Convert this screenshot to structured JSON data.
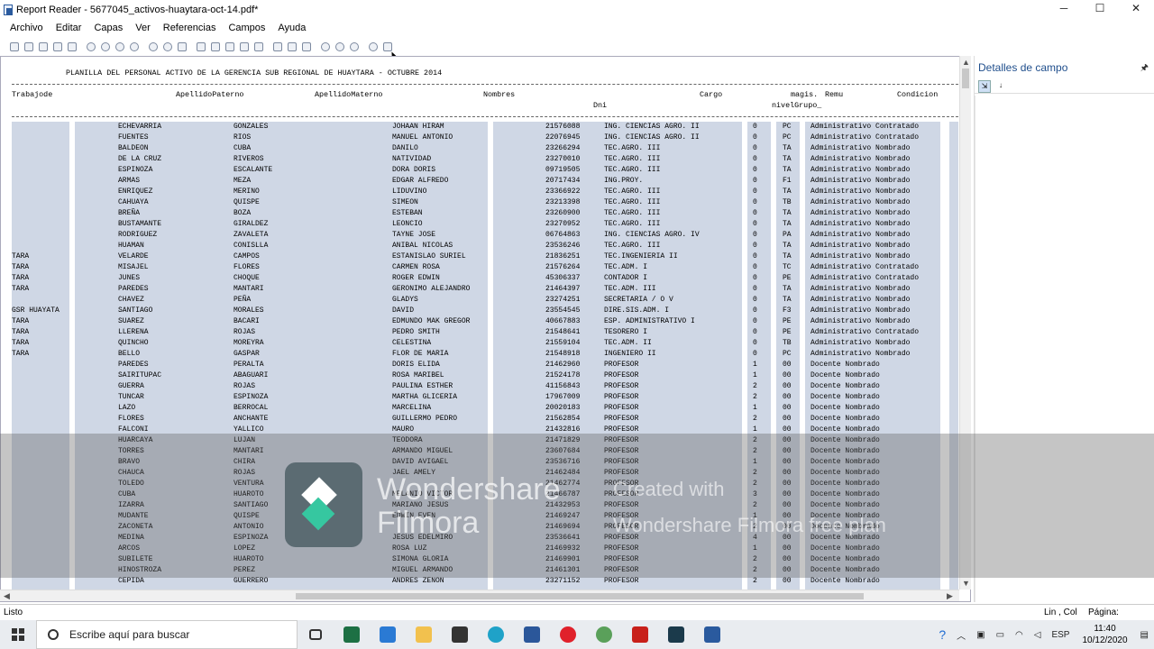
{
  "window": {
    "title": "Report Reader - 5677045_activos-huaytara-oct-14.pdf*",
    "minimize": "─",
    "maximize": "☐",
    "close": "✕"
  },
  "menu": [
    "Archivo",
    "Editar",
    "Capas",
    "Ver",
    "Referencias",
    "Campos",
    "Ayuda"
  ],
  "report": {
    "title": "PLANILLA DEL PERSONAL ACTIVO DE LA GERENCIA SUB REGIONAL DE HUAYTARA - OCTUBRE 2014",
    "headers": {
      "trabajador": "Trabajode",
      "paterno": "ApellidoPaterno",
      "materno": "ApellidoMaterno",
      "nombres": "Nombres",
      "cargo": "Cargo",
      "magis": "magis.",
      "remu": "Remu",
      "condicion": "Condicion",
      "dni": "Dni",
      "nivel": "nivelGrupo_"
    },
    "rows": [
      [
        "",
        "ECHEVARRIA",
        "GONZALES",
        "JOHAAN HIRAM",
        "21576088",
        "ING. CIENCIAS AGRO. II",
        "0",
        "PC",
        "Administrativo Contratado"
      ],
      [
        "",
        "FUENTES",
        "RIOS",
        "MANUEL ANTONIO",
        "22076945",
        "ING. CIENCIAS AGRO. II",
        "0",
        "PC",
        "Administrativo Contratado"
      ],
      [
        "",
        "BALDEON",
        "CUBA",
        "DANILO",
        "23266294",
        "TEC.AGRO.   III",
        "0",
        "TA",
        "Administrativo Nombrado"
      ],
      [
        "",
        "DE LA CRUZ",
        "RIVEROS",
        "NATIVIDAD",
        "23270010",
        "TEC.AGRO.   III",
        "0",
        "TA",
        "Administrativo Nombrado"
      ],
      [
        "",
        "ESPINOZA",
        "ESCALANTE",
        "DORA DORIS",
        "09719505",
        "TEC.AGRO.   III",
        "0",
        "TA",
        "Administrativo Nombrado"
      ],
      [
        "",
        "ARMAS",
        "MEZA",
        "EDGAR ALFREDO",
        "20717434",
        "ING.PROY.",
        "0",
        "F1",
        "Administrativo Nombrado"
      ],
      [
        "",
        "ENRIQUEZ",
        "MERINO",
        "LIDUVINO",
        "23366922",
        "TEC.AGRO.   III",
        "0",
        "TA",
        "Administrativo Nombrado"
      ],
      [
        "",
        "CAHUAYA",
        "QUISPE",
        "SIMEON",
        "23213398",
        "TEC.AGRO.   III",
        "0",
        "TB",
        "Administrativo Nombrado"
      ],
      [
        "",
        "BREÑA",
        "BOZA",
        "ESTEBAN",
        "23260900",
        "TEC.AGRO.   III",
        "0",
        "TA",
        "Administrativo Nombrado"
      ],
      [
        "",
        "BUSTAMANTE",
        "GIRALDEZ",
        "LEONCIO",
        "23270952",
        "TEC.AGRO.   III",
        "0",
        "TA",
        "Administrativo Nombrado"
      ],
      [
        "",
        "RODRIGUEZ",
        "ZAVALETA",
        "TAYNE JOSE",
        "06764863",
        "ING. CIENCIAS AGRO. IV",
        "0",
        "PA",
        "Administrativo Nombrado"
      ],
      [
        "",
        "HUAMAN",
        "CONISLLA",
        "ANIBAL NICOLAS",
        "23536246",
        "TEC.AGRO.   III",
        "0",
        "TA",
        "Administrativo Nombrado"
      ],
      [
        "TARA",
        "VELARDE",
        "CAMPOS",
        "ESTANISLAO SURIEL",
        "21836251",
        "TEC.INGENIERIA II",
        "0",
        "TA",
        "Administrativo Nombrado"
      ],
      [
        "TARA",
        "MISAJEL",
        "FLORES",
        "CARMEN ROSA",
        "21576264",
        "TEC.ADM.    I",
        "0",
        "TC",
        "Administrativo Contratado"
      ],
      [
        "TARA",
        "JUNES",
        "CHOQUE",
        "ROGER EDWIN",
        "45306337",
        "CONTADOR I",
        "0",
        "PE",
        "Administrativo Contratado"
      ],
      [
        "TARA",
        "PAREDES",
        "MANTARI",
        "GERONIMO ALEJANDRO",
        "21464397",
        "TEC.ADM.   III",
        "0",
        "TA",
        "Administrativo Nombrado"
      ],
      [
        "",
        "CHAVEZ",
        "PEÑA",
        "GLADYS",
        "23274251",
        "SECRETARIA / O V",
        "0",
        "TA",
        "Administrativo Nombrado"
      ],
      [
        "GSR HUAYATA",
        "SANTIAGO",
        "MORALES",
        "DAVID",
        "23554545",
        "DIRE.SIS.ADM. I",
        "0",
        "F3",
        "Administrativo Nombrado"
      ],
      [
        "TARA",
        "SUAREZ",
        "BACARI",
        "EDMUNDO MAK GREGOR",
        "40667883",
        "ESP. ADMINISTRATIVO I",
        "0",
        "PE",
        "Administrativo Nombrado"
      ],
      [
        "TARA",
        "LLERENA",
        "ROJAS",
        "PEDRO SMITH",
        "21548641",
        "TESORERO I",
        "0",
        "PE",
        "Administrativo Contratado"
      ],
      [
        "TARA",
        "QUINCHO",
        "MOREYRA",
        "CELESTINA",
        "21559104",
        "TEC.ADM.    II",
        "0",
        "TB",
        "Administrativo Nombrado"
      ],
      [
        "TARA",
        "BELLO",
        "GASPAR",
        "FLOR DE MARIA",
        "21548918",
        "INGENIERO II",
        "0",
        "PC",
        "Administrativo Nombrado"
      ],
      [
        "",
        "PAREDES",
        "PERALTA",
        "DORIS ELIDA",
        "21462960",
        "PROFESOR",
        "1",
        "00",
        "Docente Nombrado"
      ],
      [
        "",
        "SAIRITUPAC",
        "ABAGUARI",
        "ROSA MARIBEL",
        "21524178",
        "PROFESOR",
        "1",
        "00",
        "Docente Nombrado"
      ],
      [
        "",
        "GUERRA",
        "ROJAS",
        "PAULINA ESTHER",
        "41156843",
        "PROFESOR",
        "2",
        "00",
        "Docente Nombrado"
      ],
      [
        "",
        "TUNCAR",
        "ESPINOZA",
        "MARTHA GLICERIA",
        "17967009",
        "PROFESOR",
        "2",
        "00",
        "Docente Nombrado"
      ],
      [
        "",
        "LAZO",
        "BERROCAL",
        "MARCELINA",
        "20020183",
        "PROFESOR",
        "1",
        "00",
        "Docente Nombrado"
      ],
      [
        "",
        "FLORES",
        "ANCHANTE",
        "GUILLERMO PEDRO",
        "21562854",
        "PROFESOR",
        "2",
        "00",
        "Docente Nombrado"
      ],
      [
        "",
        "FALCONI",
        "YALLICO",
        "MAURO",
        "21432816",
        "PROFESOR",
        "1",
        "00",
        "Docente Nombrado"
      ],
      [
        "",
        "HUARCAYA",
        "LUJAN",
        "TEODORA",
        "21471829",
        "PROFESOR",
        "2",
        "00",
        "Docente Nombrado"
      ],
      [
        "",
        "TORRES",
        "MANTARI",
        "ARMANDO MIGUEL",
        "23607684",
        "PROFESOR",
        "2",
        "00",
        "Docente Nombrado"
      ],
      [
        "",
        "BRAVO",
        "CHIRA",
        "DAVID AVIGAEL",
        "23536716",
        "PROFESOR",
        "1",
        "00",
        "Docente Nombrado"
      ],
      [
        "",
        "CHAUCA",
        "ROJAS",
        "JAEL AMELY",
        "21462484",
        "PROFESOR",
        "2",
        "00",
        "Docente Nombrado"
      ],
      [
        "",
        "TOLEDO",
        "VENTURA",
        "",
        "21462774",
        "PROFESOR",
        "2",
        "00",
        "Docente Nombrado"
      ],
      [
        "",
        "CUBA",
        "HUAROTO",
        "MELANIO VICTOR",
        "21466787",
        "PROFESOR",
        "3",
        "00",
        "Docente Nombrado"
      ],
      [
        "",
        "IZARRA",
        "SANTIAGO",
        "MARIANO JESUS",
        "21432953",
        "PROFESOR",
        "2",
        "00",
        "Docente Nombrado"
      ],
      [
        "",
        "MUDANTE",
        "QUISPE",
        "EDWIN EVEN",
        "21469247",
        "PROFESOR",
        "1",
        "00",
        "Docente Nombrado"
      ],
      [
        "",
        "ZACONETA",
        "ANTONIO",
        "",
        "21469694",
        "PROFESOR",
        "2",
        "00",
        "Docente Nombrado"
      ],
      [
        "",
        "MEDINA",
        "ESPINOZA",
        "JESUS EDELMIRO",
        "23536641",
        "PROFESOR",
        "4",
        "00",
        "Docente Nombrado"
      ],
      [
        "",
        "ARCOS",
        "LOPEZ",
        "ROSA LUZ",
        "21469932",
        "PROFESOR",
        "1",
        "00",
        "Docente Nombrado"
      ],
      [
        "",
        "SUBILETE",
        "HUAROTO",
        "SIMONA GLORIA",
        "21469901",
        "PROFESOR",
        "2",
        "00",
        "Docente Nombrado"
      ],
      [
        "",
        "HINOSTROZA",
        "PEREZ",
        "MIGUEL ARMANDO",
        "21461301",
        "PROFESOR",
        "2",
        "00",
        "Docente Nombrado"
      ],
      [
        "",
        "CEPIDA",
        "GUERRERO",
        "ANDRES ZENON",
        "23271152",
        "PROFESOR",
        "2",
        "00",
        "Docente Nombrado"
      ]
    ]
  },
  "side_panel": {
    "title": "Detalles de campo",
    "pin": "🖈",
    "sort": "↓"
  },
  "status": {
    "left": "Listo",
    "linecol": "Lin , Col",
    "page": "Página:"
  },
  "watermark": {
    "brand1": "Wondershare",
    "brand2": "Filmora",
    "created": "Created with",
    "plan": "Wondershare Filmora free plan"
  },
  "taskbar": {
    "search_placeholder": "Escribe aquí para buscar",
    "lang": "ESP",
    "time": "11:40",
    "date": "10/12/2020"
  }
}
